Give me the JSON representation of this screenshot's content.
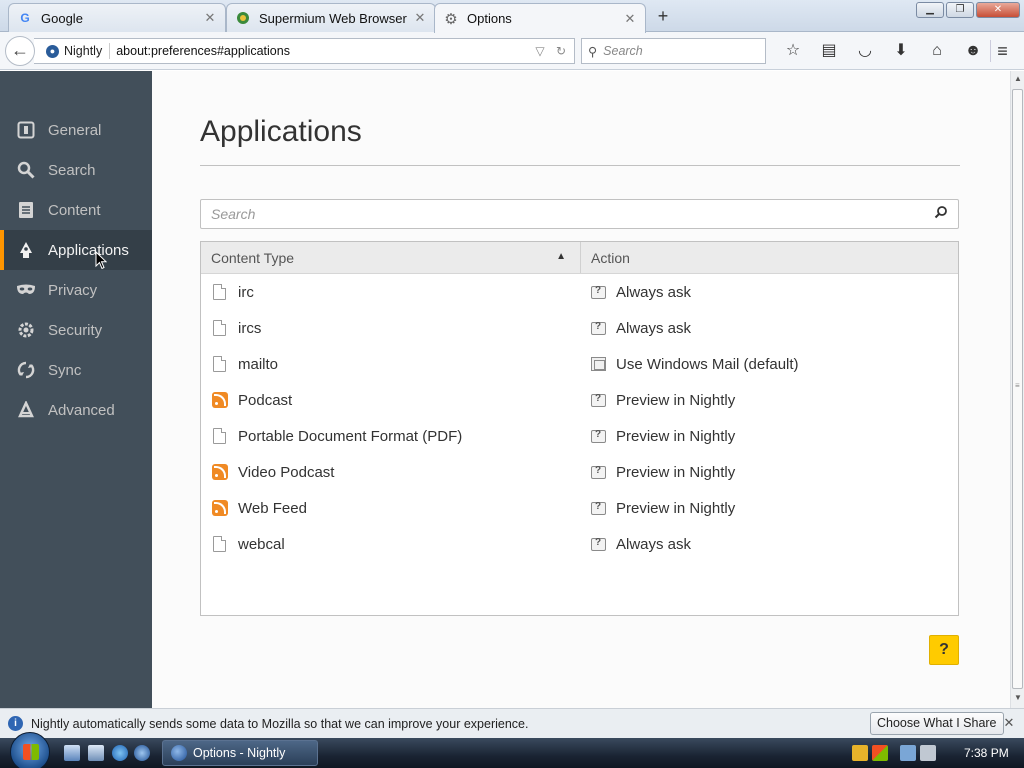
{
  "tabs": [
    {
      "label": "Google",
      "icon": "google-icon",
      "active": false
    },
    {
      "label": "Supermium Web Browser",
      "icon": "supermium-icon",
      "active": false
    },
    {
      "label": "Options",
      "icon": "gear-icon",
      "active": true
    }
  ],
  "navbar": {
    "identity_label": "Nightly",
    "url": "about:preferences#applications",
    "search_placeholder": "Search"
  },
  "sidebar": {
    "items": [
      {
        "label": "General",
        "icon": "general-icon",
        "selected": false
      },
      {
        "label": "Search",
        "icon": "search-icon",
        "selected": false
      },
      {
        "label": "Content",
        "icon": "content-icon",
        "selected": false
      },
      {
        "label": "Applications",
        "icon": "applications-icon",
        "selected": true
      },
      {
        "label": "Privacy",
        "icon": "privacy-mask-icon",
        "selected": false
      },
      {
        "label": "Security",
        "icon": "security-gear-icon",
        "selected": false
      },
      {
        "label": "Sync",
        "icon": "sync-icon",
        "selected": false
      },
      {
        "label": "Advanced",
        "icon": "advanced-icon",
        "selected": false
      }
    ]
  },
  "main": {
    "title": "Applications",
    "filter_placeholder": "Search",
    "columns": {
      "type": "Content Type",
      "action": "Action"
    },
    "rows": [
      {
        "type": "irc",
        "type_icon": "document-icon",
        "action": "Always ask",
        "action_icon": "ask-icon"
      },
      {
        "type": "ircs",
        "type_icon": "document-icon",
        "action": "Always ask",
        "action_icon": "ask-icon"
      },
      {
        "type": "mailto",
        "type_icon": "document-icon",
        "action": "Use Windows Mail (default)",
        "action_icon": "mail-app-icon"
      },
      {
        "type": "Podcast",
        "type_icon": "feed-icon",
        "action": "Preview in Nightly",
        "action_icon": "ask-icon"
      },
      {
        "type": "Portable Document Format (PDF)",
        "type_icon": "document-icon",
        "action": "Preview in Nightly",
        "action_icon": "ask-icon"
      },
      {
        "type": "Video Podcast",
        "type_icon": "feed-icon",
        "action": "Preview in Nightly",
        "action_icon": "ask-icon"
      },
      {
        "type": "Web Feed",
        "type_icon": "feed-icon",
        "action": "Preview in Nightly",
        "action_icon": "ask-icon"
      },
      {
        "type": "webcal",
        "type_icon": "document-icon",
        "action": "Always ask",
        "action_icon": "ask-icon"
      }
    ],
    "help_label": "?"
  },
  "notification": {
    "message": "Nightly automatically sends some data to Mozilla so that we can improve your experience.",
    "button": "Choose What I Share"
  },
  "taskbar": {
    "window_label": "Options - Nightly",
    "clock": "7:38 PM"
  },
  "colors": {
    "sidebar_bg": "#424f5a",
    "sidebar_selected_accent": "#ff9500",
    "help_button": "#ffcb00",
    "feed_icon": "#f08a24"
  }
}
